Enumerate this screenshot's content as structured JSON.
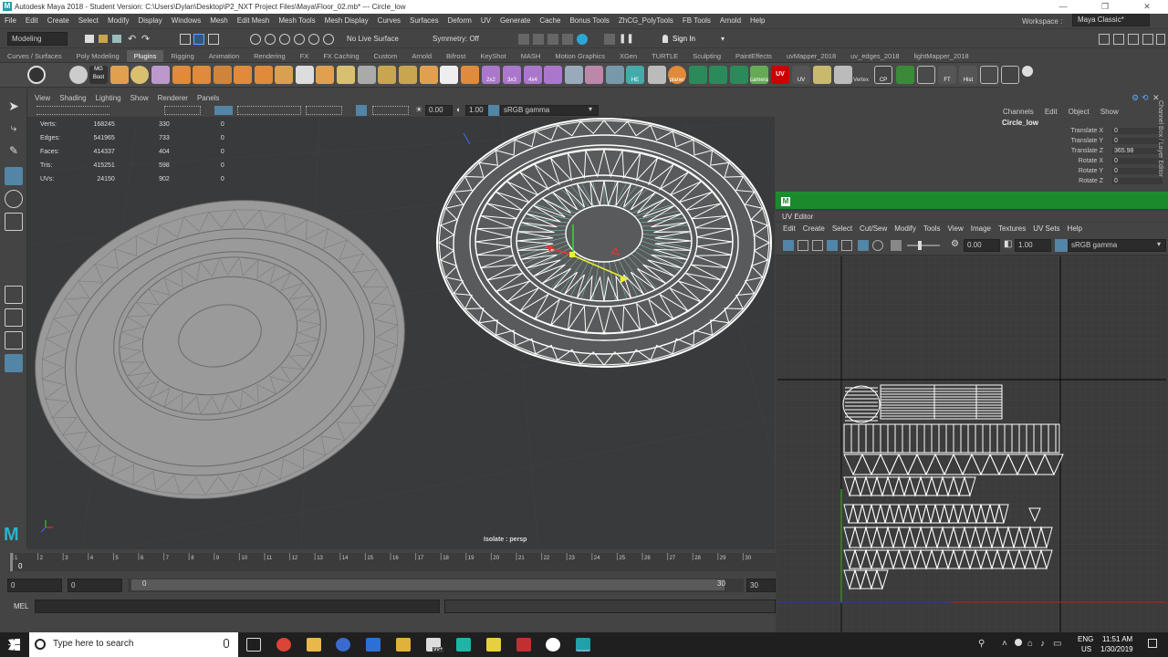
{
  "window": {
    "title": "Autodesk Maya 2018 - Student Version: C:\\Users\\Dylan\\Desktop\\P2_NXT Project Files\\Maya\\Floor_02.mb*  ---  Circle_low",
    "min": "—",
    "max": "❐",
    "close": "✕"
  },
  "menus": [
    "File",
    "Edit",
    "Create",
    "Select",
    "Modify",
    "Display",
    "Windows",
    "Mesh",
    "Edit Mesh",
    "Mesh Tools",
    "Mesh Display",
    "Curves",
    "Surfaces",
    "Deform",
    "UV",
    "Generate",
    "Cache",
    "Bonus Tools",
    "ZhCG_PolyTools",
    "FB Tools",
    "Arnold",
    "Help"
  ],
  "workspace": {
    "label": "Workspace :",
    "value": "Maya Classic*"
  },
  "status": {
    "mode": "Modeling",
    "live": "No Live Surface",
    "symmetry": "Symmetry: Off",
    "signin": "Sign In"
  },
  "shelf_tabs": [
    "Curves / Surfaces",
    "Poly Modeling",
    "Plugins",
    "Rigging",
    "Animation",
    "Rendering",
    "FX",
    "FX Caching",
    "Custom",
    "Arnold",
    "Bifrost",
    "KeyShot",
    "MASH",
    "Motion Graphics",
    "XGen",
    "TURTLE",
    "Sculpting",
    "PaintEffects",
    "uvMapper_2018",
    "uv_edges_2018",
    "lightMapper_2018"
  ],
  "shelf_active": "Plugins",
  "shelf_labels": {
    "mg": "MG\nBoot",
    "s2": "2x2",
    "s3": "3x3",
    "s4": "4x4",
    "he": "HE",
    "planer": "planer",
    "camera": "camera",
    "uv1": "UV",
    "uv2": "UV",
    "vertex": "Vertex",
    "cp": "CP",
    "ft": "FT",
    "hist": "Hist"
  },
  "viewport": {
    "menu": [
      "View",
      "Shading",
      "Lighting",
      "Show",
      "Renderer",
      "Panels"
    ],
    "exposure": "0.00",
    "gamma": "1.00",
    "colorspace": "sRGB gamma",
    "hud": [
      {
        "label": "Verts:",
        "a": "168245",
        "b": "330",
        "c": "0"
      },
      {
        "label": "Edges:",
        "a": "541965",
        "b": "733",
        "c": "0"
      },
      {
        "label": "Faces:",
        "a": "414337",
        "b": "404",
        "c": "0"
      },
      {
        "label": "Tris:",
        "a": "415251",
        "b": "598",
        "c": "0"
      },
      {
        "label": "UVs:",
        "a": "24150",
        "b": "902",
        "c": "0"
      }
    ],
    "isolate": "Isolate : persp"
  },
  "channelbox": {
    "menu": [
      "Channels",
      "Edit",
      "Object",
      "Show"
    ],
    "object": "Circle_low",
    "attrs": [
      {
        "label": "Translate X",
        "value": "0"
      },
      {
        "label": "Translate Y",
        "value": "0"
      },
      {
        "label": "Translate Z",
        "value": "365.98"
      },
      {
        "label": "Rotate X",
        "value": "0"
      },
      {
        "label": "Rotate Y",
        "value": "0"
      },
      {
        "label": "Rotate Z",
        "value": "0"
      }
    ],
    "side_tab": "Channel Box / Layer Editor"
  },
  "uveditor": {
    "title": "UV Editor",
    "menu": [
      "Edit",
      "Create",
      "Select",
      "Cut/Sew",
      "Modify",
      "Tools",
      "View",
      "Image",
      "Textures",
      "UV Sets",
      "Help"
    ],
    "exposure": "0.00",
    "gamma": "1.00",
    "colorspace": "sRGB gamma"
  },
  "timeline": {
    "ticks": [
      "1",
      "2",
      "3",
      "4",
      "5",
      "6",
      "7",
      "8",
      "9",
      "10",
      "11",
      "12",
      "13",
      "14",
      "15",
      "16",
      "17",
      "18",
      "19",
      "20",
      "21",
      "22",
      "23",
      "24",
      "25",
      "26",
      "27",
      "28",
      "29",
      "30"
    ],
    "current": "0"
  },
  "range": {
    "start": "0",
    "start2": "0",
    "inner": "0",
    "end_inner": "30",
    "end": "30"
  },
  "mel": {
    "label": "MEL"
  },
  "taskbar": {
    "search": "Type here to search",
    "lang1": "ENG",
    "lang2": "US",
    "time": "11:51 AM",
    "date": "1/30/2019",
    "badge": "99+"
  },
  "colors": {
    "maya_green": "#1a8a2c",
    "active_tab": "#5d5d5d",
    "viewport_bg": "#393a3b"
  }
}
